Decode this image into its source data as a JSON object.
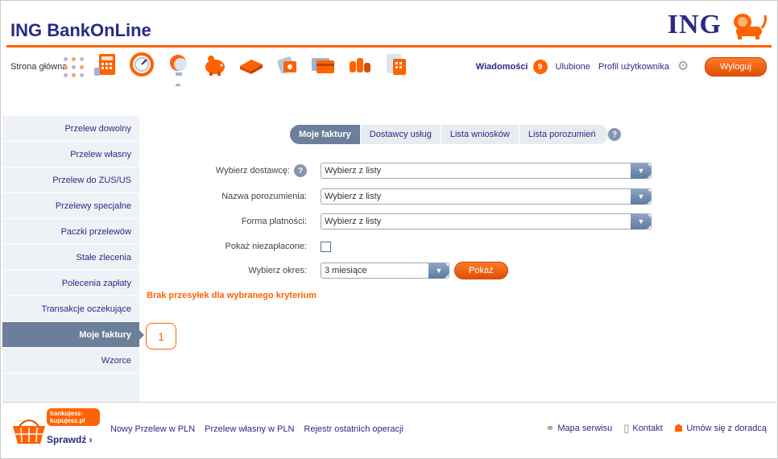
{
  "header": {
    "title": "ING BankOnLine",
    "logo_text": "ING",
    "home_label": "Strona główna",
    "messages_label": "Wiadomości",
    "messages_count": "9",
    "favorites_label": "Ulubione",
    "profile_label": "Profil użytkownika",
    "logout_label": "Wyloguj",
    "accent_color": "#ff6200",
    "brand_color": "#2a2a84"
  },
  "toolbar_icons": [
    "calculator-icon",
    "speedometer-icon",
    "globe-icon",
    "piggy-bank-icon",
    "wallet-icon",
    "money-bag-icon",
    "cards-icon",
    "coins-icon",
    "document-calculator-icon"
  ],
  "sidebar": {
    "items": [
      {
        "label": "Przelew dowolny"
      },
      {
        "label": "Przelew własny"
      },
      {
        "label": "Przelew do ZUS/US"
      },
      {
        "label": "Przelewy specjalne"
      },
      {
        "label": "Paczki przelewów"
      },
      {
        "label": "Stałe zlecenia"
      },
      {
        "label": "Polecenia zapłaty"
      },
      {
        "label": "Transakcje oczekujące"
      },
      {
        "label": "Moje faktury"
      },
      {
        "label": "Wzorce"
      }
    ],
    "active_index": 8
  },
  "callout_number": "1",
  "tabs": {
    "items": [
      {
        "label": "Moje faktury"
      },
      {
        "label": "Dostawcy usług"
      },
      {
        "label": "Lista wniosków"
      },
      {
        "label": "Lista porozumień"
      }
    ],
    "help_symbol": "?"
  },
  "form": {
    "provider_label": "Wybierz dostawcę:",
    "provider_value": "Wybierz z listy",
    "agreement_label": "Nazwa porozumienia:",
    "agreement_value": "Wybierz z listy",
    "payment_label": "Forma płatności:",
    "payment_value": "Wybierz z listy",
    "unpaid_label": "Pokaż niezapłacone:",
    "period_label": "Wybierz okres:",
    "period_value": "3 miesiące",
    "show_label": "Pokaż"
  },
  "no_results": "Brak przesyłek dla wybranego kryterium",
  "footer": {
    "promo_text": "bankujesz-kupujesz.pl",
    "promo_cta": "Sprawdź",
    "links": [
      "Nowy Przelew w PLN",
      "Przelew własny w PLN",
      "Rejestr ostatnich operacji"
    ],
    "sitemap_label": "Mapa serwisu",
    "contact_label": "Kontakt",
    "advisor_label": "Umów się z doradcą"
  }
}
